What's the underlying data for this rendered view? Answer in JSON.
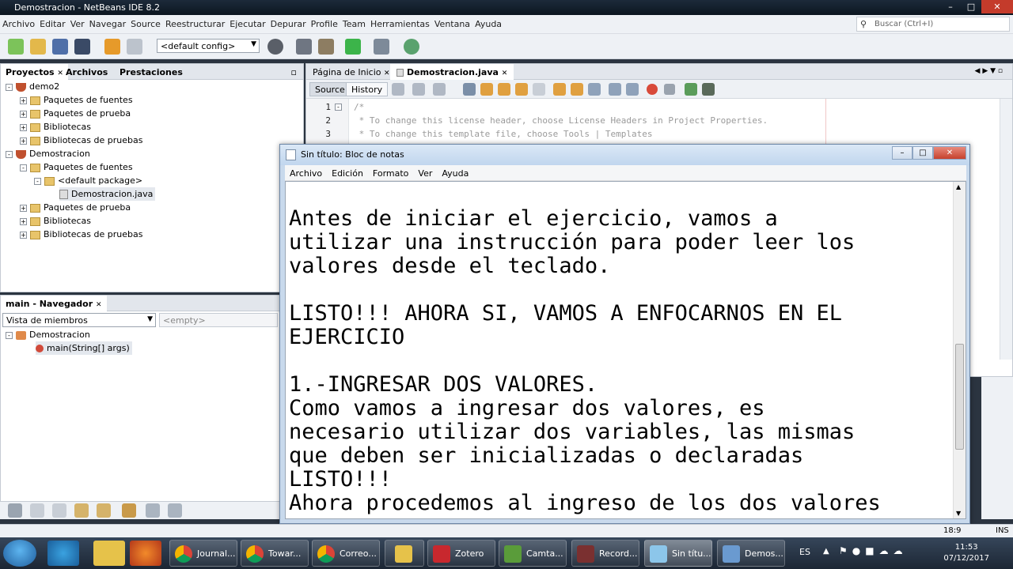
{
  "nb_window": {
    "title": "Demostracion - NetBeans IDE 8.2"
  },
  "menu": [
    "Archivo",
    "Editar",
    "Ver",
    "Navegar",
    "Source",
    "Reestructurar",
    "Ejecutar",
    "Depurar",
    "Profile",
    "Team",
    "Herramientas",
    "Ventana",
    "Ayuda"
  ],
  "search": {
    "placeholder": "Buscar (Ctrl+I)"
  },
  "toolbar": {
    "config": "<default config>"
  },
  "projects_tabs": [
    "Proyectos",
    "Archivos",
    "Prestaciones"
  ],
  "tree": [
    {
      "label": "demo2",
      "level": 0,
      "kind": "project"
    },
    {
      "label": "Paquetes de fuentes",
      "level": 1,
      "kind": "folder"
    },
    {
      "label": "Paquetes de prueba",
      "level": 1,
      "kind": "folder"
    },
    {
      "label": "Bibliotecas",
      "level": 1,
      "kind": "folder"
    },
    {
      "label": "Bibliotecas de pruebas",
      "level": 1,
      "kind": "folder"
    },
    {
      "label": "Demostracion",
      "level": 0,
      "kind": "project"
    },
    {
      "label": "Paquetes de fuentes",
      "level": 1,
      "kind": "folder"
    },
    {
      "label": "<default package>",
      "level": 2,
      "kind": "folder"
    },
    {
      "label": "Demostracion.java",
      "level": 3,
      "kind": "file"
    },
    {
      "label": "Paquetes de prueba",
      "level": 1,
      "kind": "folder"
    },
    {
      "label": "Bibliotecas",
      "level": 1,
      "kind": "folder"
    },
    {
      "label": "Bibliotecas de pruebas",
      "level": 1,
      "kind": "folder"
    }
  ],
  "navigator": {
    "title": "main - Navegador",
    "member_view": "Vista de miembros",
    "empty": "<empty>",
    "items": [
      "Demostracion",
      "main(String[] args)"
    ]
  },
  "editor": {
    "tabs": [
      "Página de Inicio",
      "Demostracion.java"
    ],
    "source_label": "Source",
    "history_label": "History",
    "lines": [
      {
        "n": "1",
        "text": "/*"
      },
      {
        "n": "2",
        "text": " * To change this license header, choose License Headers in Project Properties."
      },
      {
        "n": "3",
        "text": " * To change this template file, choose Tools | Templates"
      }
    ]
  },
  "notepad": {
    "title": "Sin título: Bloc de notas",
    "menu": [
      "Archivo",
      "Edición",
      "Formato",
      "Ver",
      "Ayuda"
    ],
    "text": "Antes de iniciar el ejercicio, vamos a\nutilizar una instrucción para poder leer los\nvalores desde el teclado.\n\nLISTO!!! AHORA SI, VAMOS A ENFOCARNOS EN EL\nEJERCICIO\n\n1.-INGRESAR DOS VALORES.\nComo vamos a ingresar dos valores, es\nnecesario utilizar dos variables, las mismas\nque deben ser inicializadas o declaradas\nLISTO!!!\nAhora procedemos al ingreso de los dos valores"
  },
  "statusbar": {
    "position": "18:9",
    "mode": "INS"
  },
  "taskbar": {
    "tasks": [
      "Journal...",
      "Towar...",
      "Correo...",
      "",
      "Zotero",
      "Camta...",
      "Record...",
      "Sin títu...",
      "Demos..."
    ],
    "lang": "ES",
    "time": "11:53",
    "date": "07/12/2017"
  }
}
